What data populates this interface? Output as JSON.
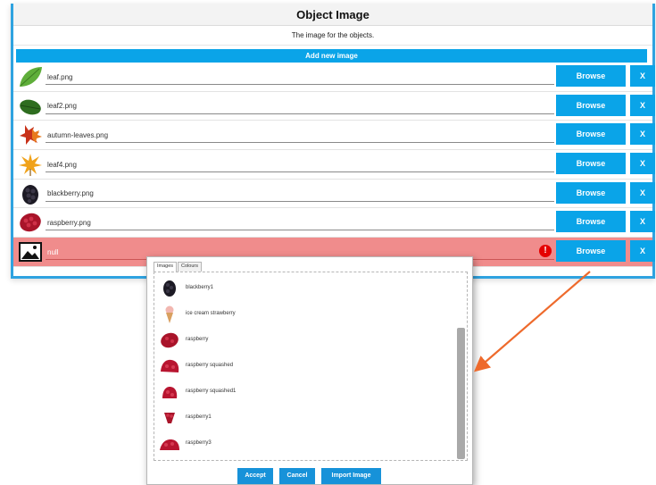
{
  "panel": {
    "title": "Object Image",
    "description": "The image for the objects.",
    "add_button": "Add new image",
    "rows": [
      {
        "filename": "leaf.png",
        "icon": "leaf-icon",
        "browse": "Browse",
        "remove": "X",
        "error": false
      },
      {
        "filename": "leaf2.png",
        "icon": "leaf2-icon",
        "browse": "Browse",
        "remove": "X",
        "error": false
      },
      {
        "filename": "autumn-leaves.png",
        "icon": "autumn-leaves-icon",
        "browse": "Browse",
        "remove": "X",
        "error": false
      },
      {
        "filename": "leaf4.png",
        "icon": "leaf4-icon",
        "browse": "Browse",
        "remove": "X",
        "error": false
      },
      {
        "filename": "blackberry.png",
        "icon": "blackberry-icon",
        "browse": "Browse",
        "remove": "X",
        "error": false
      },
      {
        "filename": "raspberry.png",
        "icon": "raspberry-icon",
        "browse": "Browse",
        "remove": "X",
        "error": false
      },
      {
        "filename": "null",
        "icon": "broken-image-icon",
        "browse": "Browse",
        "remove": "X",
        "error": true,
        "error_mark": "!"
      }
    ]
  },
  "popup": {
    "tabs": [
      "Images",
      "Colours"
    ],
    "active_tab": "Images",
    "items": [
      {
        "label": "blackberry1",
        "icon": "blackberry-icon"
      },
      {
        "label": "ice cream strawberry",
        "icon": "ice-cream-icon"
      },
      {
        "label": "raspberry",
        "icon": "raspberry-icon"
      },
      {
        "label": "raspberry squashed",
        "icon": "raspberry-squashed-icon"
      },
      {
        "label": "raspberry squashed1",
        "icon": "raspberry-squashed-icon"
      },
      {
        "label": "raspberry1",
        "icon": "raspberry-icon"
      },
      {
        "label": "raspberry3",
        "icon": "raspberry-squashed-icon"
      }
    ],
    "buttons": {
      "accept": "Accept",
      "cancel": "Cancel",
      "import": "Import Image"
    }
  },
  "colors": {
    "accent": "#0aa4e8",
    "panel_border": "#2fa3e0",
    "error_row": "#f08c8c",
    "arrow": "#ee6a2c"
  }
}
